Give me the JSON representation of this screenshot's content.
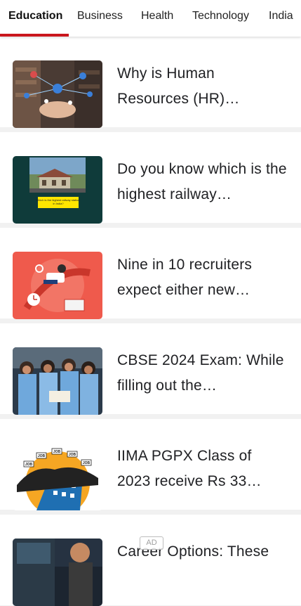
{
  "tabs": [
    {
      "label": "Education",
      "active": true
    },
    {
      "label": "Business",
      "active": false
    },
    {
      "label": "Health",
      "active": false
    },
    {
      "label": "Technology",
      "active": false
    },
    {
      "label": "India",
      "active": false
    }
  ],
  "accent_color": "#c9161d",
  "articles": [
    {
      "title": "Why is Human Resources (HR)…",
      "image": "hr-network-warehouse-image"
    },
    {
      "title": "Do you know which is the highest railway…",
      "image": "railway-station-image",
      "image_caption": "Which is the highest railway station in India?"
    },
    {
      "title": "Nine in 10 recruiters expect either new…",
      "image": "recruiter-illustration-image"
    },
    {
      "title": "CBSE 2024 Exam: While filling out the…",
      "image": "students-image"
    },
    {
      "title": "IIMA PGPX Class of 2023 receive Rs 33…",
      "image": "job-crowd-illustration-image",
      "sign_labels": [
        "JOB",
        "JOB",
        "JOB",
        "JOB",
        "JOB"
      ]
    },
    {
      "title": "Career Options: These",
      "image": "career-person-image"
    }
  ],
  "ad_label": "AD"
}
